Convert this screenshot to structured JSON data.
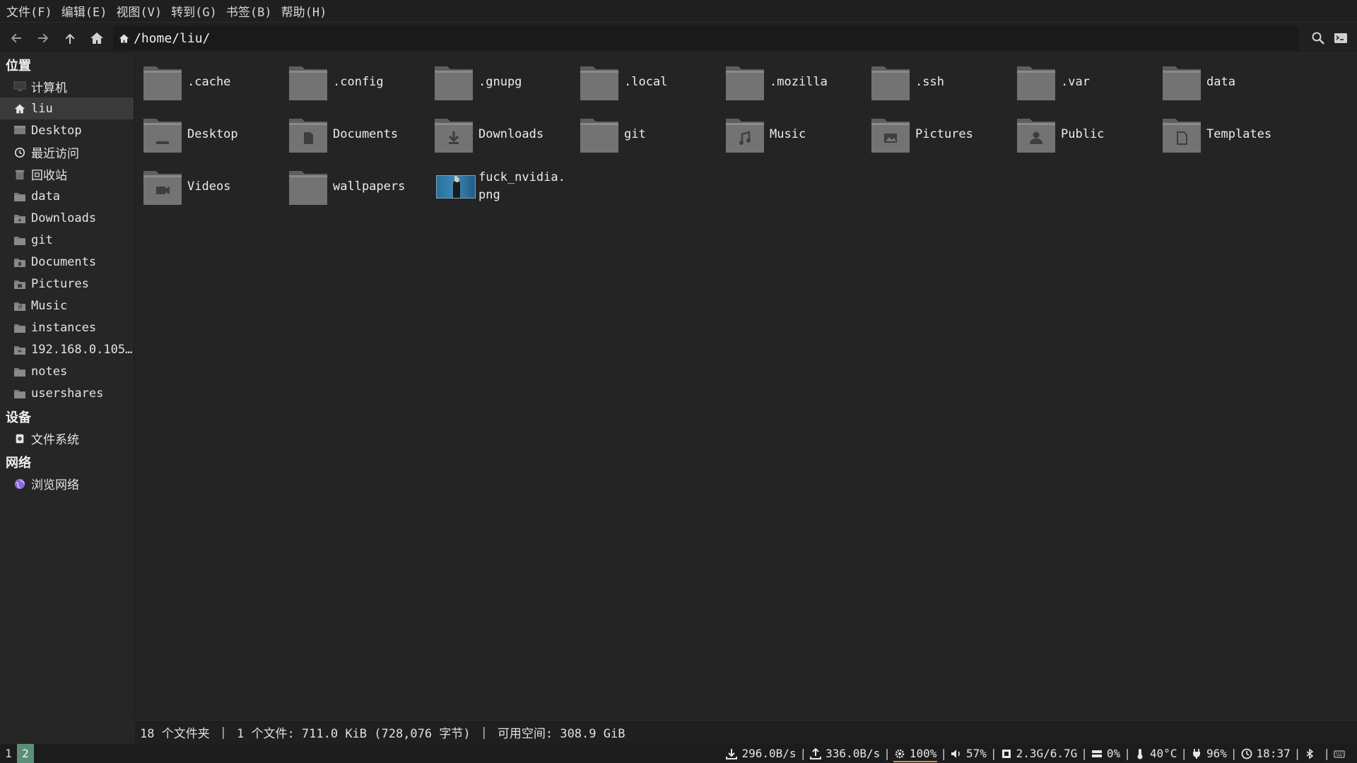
{
  "menu": [
    "文件(F)",
    "编辑(E)",
    "视图(V)",
    "转到(G)",
    "书签(B)",
    "帮助(H)"
  ],
  "toolbar": {
    "path": "/home/liu/",
    "icons": [
      "back-arrow-icon",
      "forward-arrow-icon",
      "up-arrow-icon",
      "home-icon",
      "search-icon",
      "terminal-icon"
    ]
  },
  "sidebar": {
    "places_header": "位置",
    "places": [
      {
        "label": "计算机",
        "icon": "computer-icon"
      },
      {
        "label": "liu",
        "icon": "home-icon",
        "active": true
      },
      {
        "label": "Desktop",
        "icon": "desktop-icon"
      },
      {
        "label": "最近访问",
        "icon": "clock-icon"
      },
      {
        "label": "回收站",
        "icon": "trash-icon"
      },
      {
        "label": "data",
        "icon": "folder-icon"
      },
      {
        "label": "Downloads",
        "icon": "folder-download-icon"
      },
      {
        "label": "git",
        "icon": "folder-icon"
      },
      {
        "label": "Documents",
        "icon": "folder-documents-icon"
      },
      {
        "label": "Pictures",
        "icon": "folder-pictures-icon"
      },
      {
        "label": "Music",
        "icon": "folder-music-icon"
      },
      {
        "label": "instances",
        "icon": "folder-icon"
      },
      {
        "label": "192.168.0.105...",
        "icon": "network-folder-icon"
      },
      {
        "label": "notes",
        "icon": "folder-icon"
      },
      {
        "label": "usershares",
        "icon": "folder-icon"
      }
    ],
    "devices_header": "设备",
    "devices": [
      {
        "label": "文件系统",
        "icon": "drive-icon"
      }
    ],
    "network_header": "网络",
    "network": [
      {
        "label": "浏览网络",
        "icon": "network-globe-icon"
      }
    ]
  },
  "files": [
    {
      "name": ".cache",
      "emblem": "none"
    },
    {
      "name": ".config",
      "emblem": "none"
    },
    {
      "name": ".gnupg",
      "emblem": "none"
    },
    {
      "name": ".local",
      "emblem": "none"
    },
    {
      "name": ".mozilla",
      "emblem": "none"
    },
    {
      "name": ".ssh",
      "emblem": "none"
    },
    {
      "name": ".var",
      "emblem": "none"
    },
    {
      "name": "data",
      "emblem": "none"
    },
    {
      "name": "Desktop",
      "emblem": "desktop"
    },
    {
      "name": "Documents",
      "emblem": "document"
    },
    {
      "name": "Downloads",
      "emblem": "download"
    },
    {
      "name": "git",
      "emblem": "none"
    },
    {
      "name": "Music",
      "emblem": "music"
    },
    {
      "name": "Pictures",
      "emblem": "picture"
    },
    {
      "name": "Public",
      "emblem": "person"
    },
    {
      "name": "Templates",
      "emblem": "template"
    },
    {
      "name": "Videos",
      "emblem": "video"
    },
    {
      "name": "wallpapers",
      "emblem": "none"
    },
    {
      "name": "fuck_nvidia.png",
      "emblem": "image-thumbnail"
    }
  ],
  "status": {
    "folders": "18 个文件夹",
    "selection": "1 个文件: 711.0 KiB (728,076 字节)",
    "free": "可用空间: 308.9 GiB",
    "separator": "|"
  },
  "panel": {
    "workspaces": [
      {
        "label": "1",
        "active": false
      },
      {
        "label": "2",
        "active": true
      }
    ],
    "modules": [
      {
        "icon": "download-icon",
        "text": "296.0B/s",
        "color": ""
      },
      {
        "icon": "upload-icon",
        "text": "336.0B/s",
        "color": ""
      },
      {
        "icon": "cpu-gear-icon",
        "text": "100%",
        "color": "#e08a2c"
      },
      {
        "icon": "volume-icon",
        "text": "57%",
        "color": ""
      },
      {
        "icon": "memory-icon",
        "text": "2.3G/6.7G",
        "color": ""
      },
      {
        "icon": "disk-icon",
        "text": "0%",
        "color": ""
      },
      {
        "icon": "thermometer-icon",
        "text": "40°C",
        "color": ""
      },
      {
        "icon": "battery-plug-icon",
        "text": "96%",
        "color": ""
      },
      {
        "icon": "clock-icon",
        "text": "18:37",
        "color": ""
      },
      {
        "icon": "bluetooth-icon",
        "text": "",
        "color": ""
      },
      {
        "icon": "keyboard-icon",
        "text": "",
        "color": ""
      }
    ],
    "separator": "|"
  },
  "colors": {
    "background": "#232323",
    "sidebar": "#262626",
    "folder": "#6b6b6b",
    "active_workspace": "#5a8f78",
    "cpu_warning": "#e08a2c"
  }
}
